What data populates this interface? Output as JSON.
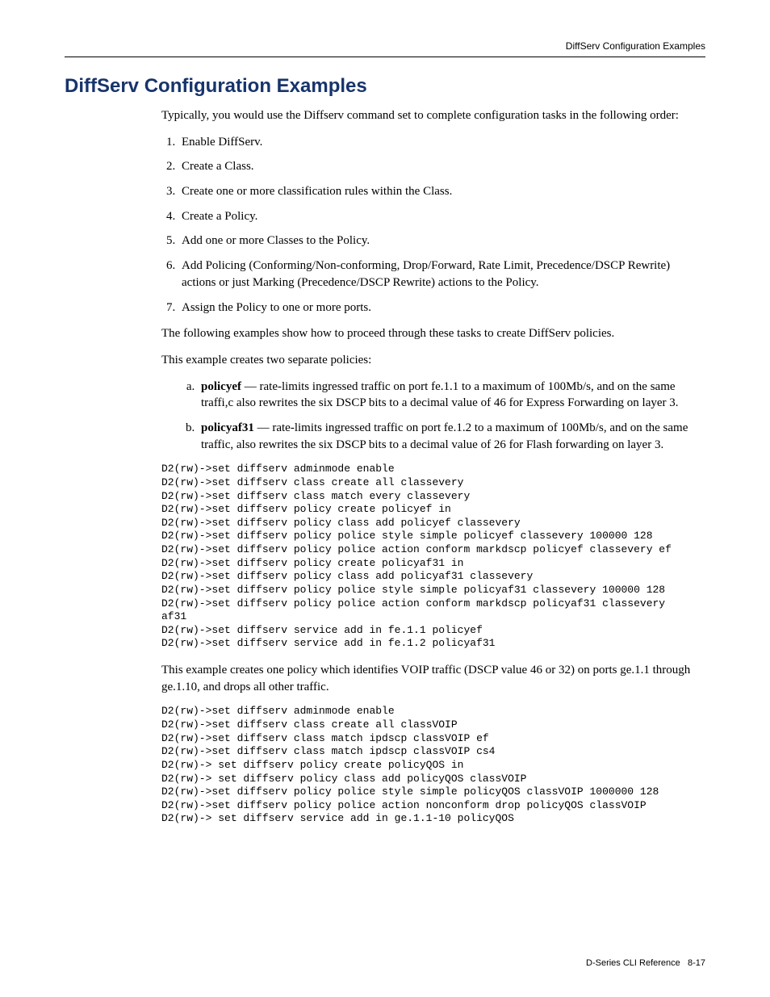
{
  "running_head": "DiffServ Configuration Examples",
  "title": "DiffServ Configuration Examples",
  "intro": "Typically, you would use the Diffserv command set to complete configuration tasks in the following order:",
  "steps": [
    "Enable DiffServ.",
    "Create a Class.",
    "Create one or more classification rules within the Class.",
    "Create a Policy.",
    "Add one or more Classes to the Policy.",
    "Add Policing (Conforming/Non-conforming, Drop/Forward, Rate Limit, Precedence/DSCP Rewrite) actions or just Marking (Precedence/DSCP Rewrite) actions to the Policy.",
    "Assign the Policy to one or more ports."
  ],
  "after_steps_1": "The following examples show how to proceed through these tasks to create DiffServ policies.",
  "after_steps_2": "This example creates two separate policies:",
  "policies": [
    {
      "name": "policyef",
      "desc": " — rate-limits ingressed traffic on port fe.1.1 to a maximum of 100Mb/s, and on the same traffi,c also rewrites the six DSCP bits to a decimal value of 46 for Express Forwarding on layer 3."
    },
    {
      "name": "policyaf31",
      "desc": " — rate-limits ingressed traffic on port fe.1.2 to a maximum of 100Mb/s, and on the same traffic, also rewrites the six DSCP bits to a decimal value of 26 for Flash forwarding on layer 3."
    }
  ],
  "code1": "D2(rw)->set diffserv adminmode enable\nD2(rw)->set diffserv class create all classevery\nD2(rw)->set diffserv class match every classevery\nD2(rw)->set diffserv policy create policyef in\nD2(rw)->set diffserv policy class add policyef classevery\nD2(rw)->set diffserv policy police style simple policyef classevery 100000 128\nD2(rw)->set diffserv policy police action conform markdscp policyef classevery ef\nD2(rw)->set diffserv policy create policyaf31 in\nD2(rw)->set diffserv policy class add policyaf31 classevery\nD2(rw)->set diffserv policy police style simple policyaf31 classevery 100000 128\nD2(rw)->set diffserv policy police action conform markdscp policyaf31 classevery\naf31\nD2(rw)->set diffserv service add in fe.1.1 policyef\nD2(rw)->set diffserv service add in fe.1.2 policyaf31",
  "example2_intro": "This example creates one policy which identifies VOIP traffic (DSCP value 46 or 32) on ports ge.1.1 through ge.1.10, and drops all other traffic.",
  "code2": "D2(rw)->set diffserv adminmode enable\nD2(rw)->set diffserv class create all classVOIP\nD2(rw)->set diffserv class match ipdscp classVOIP ef\nD2(rw)->set diffserv class match ipdscp classVOIP cs4\nD2(rw)-> set diffserv policy create policyQOS in\nD2(rw)-> set diffserv policy class add policyQOS classVOIP\nD2(rw)->set diffserv policy police style simple policyQOS classVOIP 1000000 128\nD2(rw)->set diffserv policy police action nonconform drop policyQOS classVOIP\nD2(rw)-> set diffserv service add in ge.1.1-10 policyQOS",
  "footer_doc": "D-Series CLI Reference",
  "footer_page": "8-17"
}
